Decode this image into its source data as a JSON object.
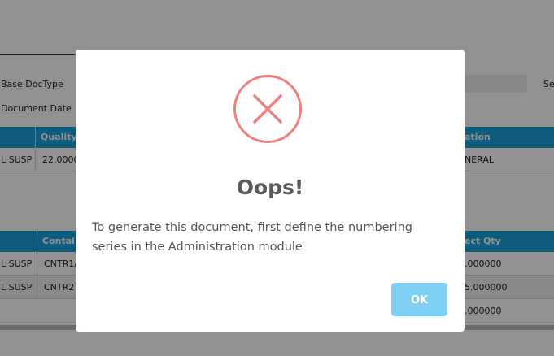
{
  "background": {
    "labels": {
      "base_doctype": "Base DocType",
      "document_date": "Document Date",
      "right_cut": "Se"
    },
    "table1": {
      "headers": {
        "col2": "Quality",
        "col_right": "ation"
      },
      "row": {
        "c1": "L SUSP",
        "c2": "22.0000",
        "c_right": "NERAL"
      }
    },
    "table2": {
      "headers": {
        "col2": "Contai",
        "col_right": "ect Qty"
      },
      "rows": [
        {
          "c1": "L SUSP",
          "c2": "CNTR1/",
          "c_right": ".000000"
        },
        {
          "c1": "L SUSP",
          "c2": "CNTR2",
          "c_right": "5.000000"
        },
        {
          "c_right": ".000000"
        }
      ]
    }
  },
  "dialog": {
    "title": "Oops!",
    "message": "To generate this document, first define the numbering series in the Administration module",
    "ok_label": "OK",
    "icon": "error-x-icon"
  },
  "colors": {
    "table_header": "#1aa0d8",
    "error_icon": "#f07f7f",
    "ok_button": "#7fd0f5"
  }
}
